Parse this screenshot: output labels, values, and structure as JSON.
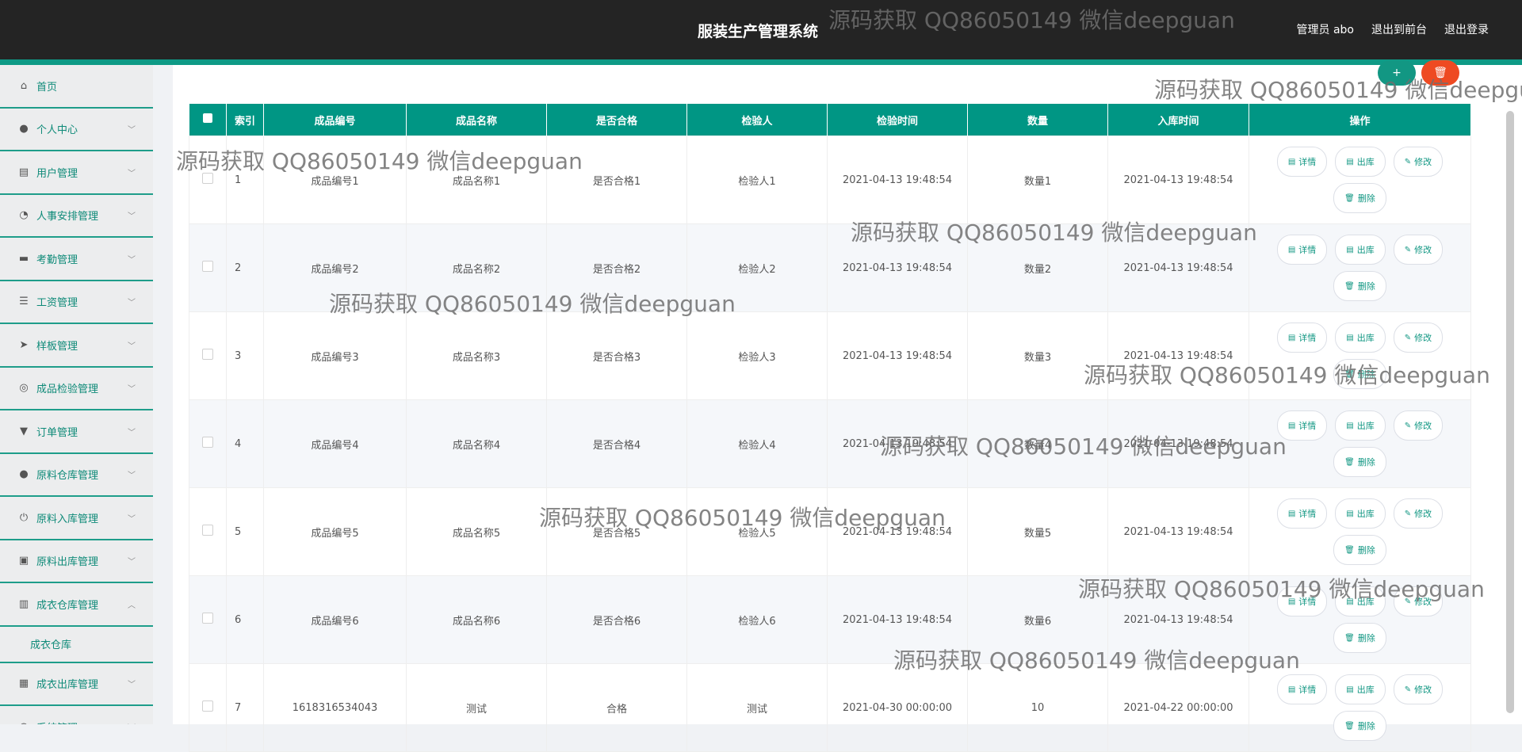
{
  "header": {
    "title": "服装生产管理系统",
    "admin": "管理员 abo",
    "to_front": "退出到前台",
    "logout": "退出登录"
  },
  "sidebar": {
    "items": [
      {
        "label": "首页",
        "icon": "home-icon",
        "glyph": "⌂"
      },
      {
        "label": "个人中心",
        "icon": "user-icon",
        "glyph": "●"
      },
      {
        "label": "用户管理",
        "icon": "book-icon",
        "glyph": "▤"
      },
      {
        "label": "人事安排管理",
        "icon": "dashboard-icon",
        "glyph": "◔"
      },
      {
        "label": "考勤管理",
        "icon": "comment-icon",
        "glyph": "▬"
      },
      {
        "label": "工资管理",
        "icon": "list-icon",
        "glyph": "☰"
      },
      {
        "label": "样板管理",
        "icon": "send-icon",
        "glyph": "➤"
      },
      {
        "label": "成品检验管理",
        "icon": "lifebuoy-icon",
        "glyph": "◎"
      },
      {
        "label": "订单管理",
        "icon": "stamp-icon",
        "glyph": "▼"
      },
      {
        "label": "原料仓库管理",
        "icon": "user-icon",
        "glyph": "●"
      },
      {
        "label": "原料入库管理",
        "icon": "power-icon",
        "glyph": "⏻"
      },
      {
        "label": "原料出库管理",
        "icon": "delete-box-icon",
        "glyph": "▣"
      },
      {
        "label": "成衣仓库管理",
        "icon": "bar-chart-icon",
        "glyph": "▥"
      },
      {
        "label": "成衣出库管理",
        "icon": "clipboard-icon",
        "glyph": "▦"
      },
      {
        "label": "系统管理",
        "icon": "globe-icon",
        "glyph": "◍"
      }
    ],
    "sub": "成衣仓库"
  },
  "fab": {
    "add": "+",
    "del": "🗑"
  },
  "table": {
    "headers": [
      "索引",
      "成品编号",
      "成品名称",
      "是否合格",
      "检验人",
      "检验时间",
      "数量",
      "入库时间",
      "操作"
    ],
    "rows": [
      [
        "1",
        "成品编号1",
        "成品名称1",
        "是否合格1",
        "检验人1",
        "2021-04-13 19:48:54",
        "数量1",
        "2021-04-13 19:48:54"
      ],
      [
        "2",
        "成品编号2",
        "成品名称2",
        "是否合格2",
        "检验人2",
        "2021-04-13 19:48:54",
        "数量2",
        "2021-04-13 19:48:54"
      ],
      [
        "3",
        "成品编号3",
        "成品名称3",
        "是否合格3",
        "检验人3",
        "2021-04-13 19:48:54",
        "数量3",
        "2021-04-13 19:48:54"
      ],
      [
        "4",
        "成品编号4",
        "成品名称4",
        "是否合格4",
        "检验人4",
        "2021-04-13 19:48:54",
        "数量4",
        "2021-04-13 19:48:54"
      ],
      [
        "5",
        "成品编号5",
        "成品名称5",
        "是否合格5",
        "检验人5",
        "2021-04-13 19:48:54",
        "数量5",
        "2021-04-13 19:48:54"
      ],
      [
        "6",
        "成品编号6",
        "成品名称6",
        "是否合格6",
        "检验人6",
        "2021-04-13 19:48:54",
        "数量6",
        "2021-04-13 19:48:54"
      ],
      [
        "7",
        "1618316534043",
        "测试",
        "合格",
        "测试",
        "2021-04-30 00:00:00",
        "10",
        "2021-04-22 00:00:00"
      ]
    ],
    "ops": {
      "detail": "详情",
      "outbound": "出库",
      "edit": "修改",
      "delete": "删除"
    }
  },
  "watermark": "源码获取 QQ86050149 微信deepguan",
  "colors": {
    "accent": "#009684",
    "topbar": "#242424",
    "danger": "#ee4a22"
  }
}
